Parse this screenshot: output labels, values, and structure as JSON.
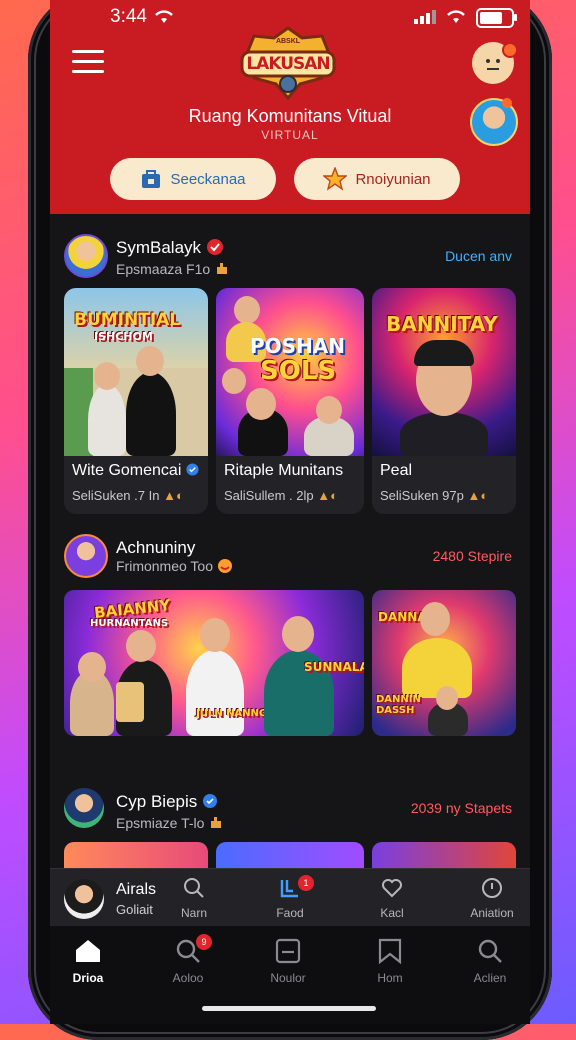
{
  "status_bar": {
    "time": "3:44"
  },
  "header": {
    "logo_text": "LAKUSAN",
    "logo_top": "ABSKL",
    "title": "Ruang Komunitans Vitual",
    "subtitle": "VIRTUAL",
    "pill_left": "Seeckanaa",
    "pill_right": "Rnoiyunian"
  },
  "sections": [
    {
      "name": "SymBalayk",
      "sub": "Epsmaaza F1o",
      "link": "Ducen anv",
      "link_color": "#3fb0ff",
      "cards": [
        {
          "poster": "BUMINTIAL",
          "poster2": "ISHCHOM",
          "title": "Wite Gomencai",
          "meta": "SeliSuken .7 In"
        },
        {
          "poster": "POSHAN",
          "poster2": "SOLS",
          "title": "Ritaple Munitans",
          "meta": "SaliSullem . 2lp"
        },
        {
          "poster": "BANNITAY",
          "poster2": "",
          "title": "Peal",
          "meta": "SeliSuken  97p"
        }
      ]
    },
    {
      "name": "Achnuniny",
      "sub": "Frimonmeo Too",
      "link": "2480 Stepire",
      "link_color": "#ff5a5f",
      "banners": [
        {
          "poster": "BAIANNY",
          "poster2": "HURNANTANS",
          "poster3": "JULN NANNGH",
          "poster4": "SUNNALAH"
        },
        {
          "poster": "DANNAS",
          "poster2": "DANNIN DASSH"
        }
      ]
    },
    {
      "name": "Cyp Biepis",
      "sub": "Epsmiaze T-lo",
      "link": "2039 ny Stapets"
    }
  ],
  "mini_player": {
    "name": "Airals",
    "sub": "Goliait",
    "items": [
      {
        "icon": "search-icon",
        "label": "Narn"
      },
      {
        "icon": "feed-icon",
        "label": "Faod",
        "badge": "1"
      },
      {
        "icon": "heart-icon",
        "label": "Kacl"
      },
      {
        "icon": "info-icon",
        "label": "Aniation"
      }
    ]
  },
  "tabbar": [
    {
      "icon": "home-icon",
      "label": "Drioa",
      "active": true
    },
    {
      "icon": "search-icon",
      "label": "Aoloo",
      "badge": "9"
    },
    {
      "icon": "square-icon",
      "label": "Noulor"
    },
    {
      "icon": "bookmark-icon",
      "label": "Hom"
    },
    {
      "icon": "search-icon",
      "label": "Aclien"
    }
  ],
  "colors": {
    "header_red": "#c91c22",
    "background": "#151517",
    "accent_blue": "#3fb0ff",
    "accent_red": "#ff5a5f"
  }
}
